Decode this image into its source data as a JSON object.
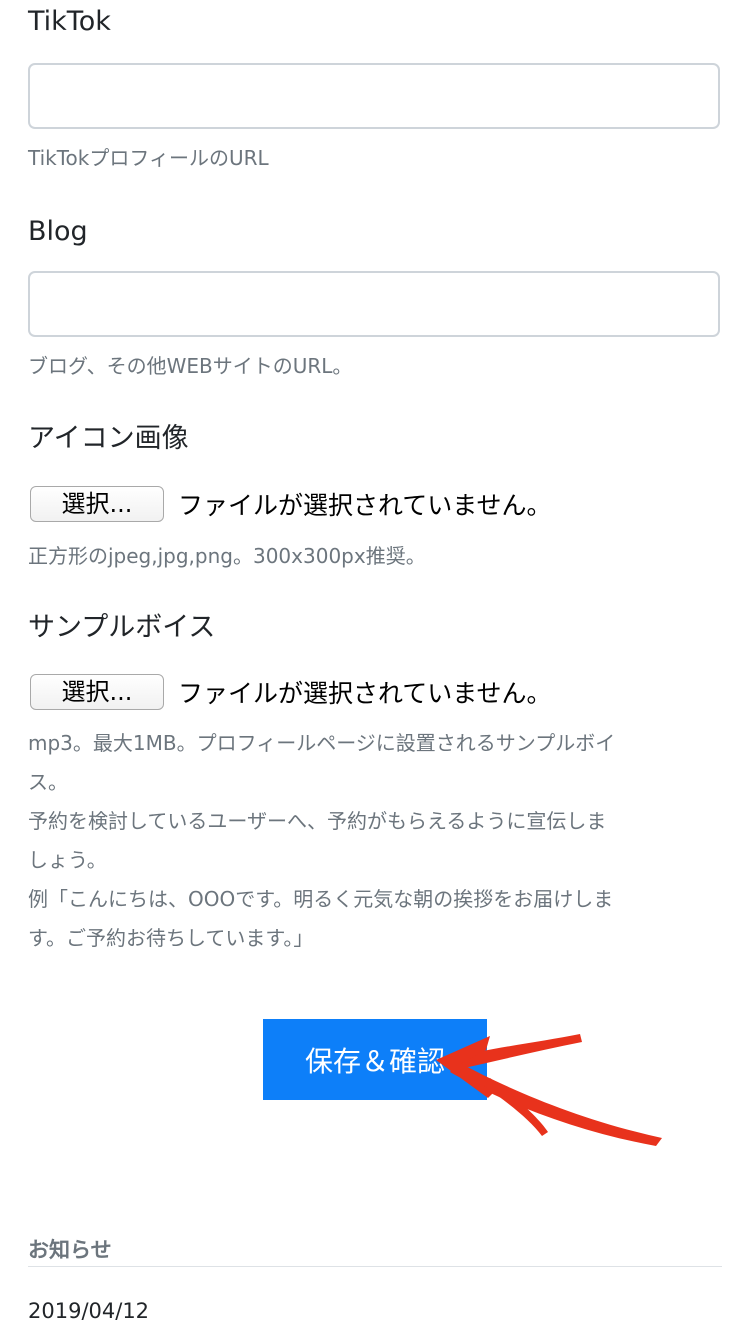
{
  "tiktok": {
    "label": "TikTok",
    "value": "",
    "help": "TikTokプロフィールのURL"
  },
  "blog": {
    "label": "Blog",
    "value": "",
    "help": "ブログ、その他WEBサイトのURL。"
  },
  "icon_image": {
    "label": "アイコン画像",
    "button_label": "選択...",
    "file_status": "ファイルが選択されていません。",
    "help": "正方形のjpeg,jpg,png。300x300px推奨。"
  },
  "sample_voice": {
    "label": "サンプルボイス",
    "button_label": "選択...",
    "file_status": "ファイルが選択されていません。",
    "help_lines": [
      "mp3。最大1MB。プロフィールページに設置されるサンプルボイ",
      "ス。",
      "予約を検討しているユーザーへ、予約がもらえるように宣伝しま",
      "しょう。",
      "例「こんにちは、OOOです。明るく元気な朝の挨拶をお届けしま",
      "す。ご予約お待ちしています。」"
    ]
  },
  "save_button": {
    "label": "保存＆確認"
  },
  "annotation": {
    "arrow_color": "#e8321c"
  },
  "notice": {
    "title": "お知らせ",
    "date": "2019/04/12"
  },
  "colors": {
    "primary": "#0d7ff9",
    "muted_text": "#6c757d",
    "border": "#ced4da"
  }
}
